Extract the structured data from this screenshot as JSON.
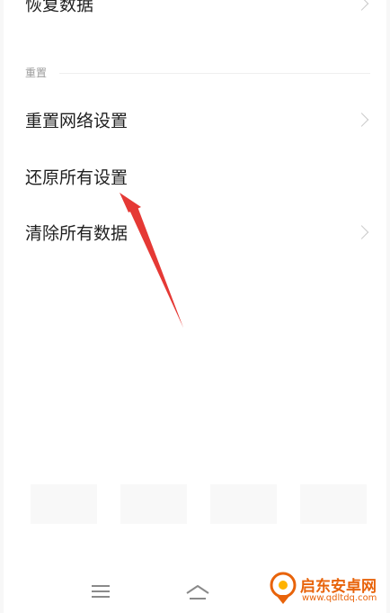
{
  "rows": {
    "restore_data": "恢复数据",
    "reset_network": "重置网络设置",
    "restore_all": "还原所有设置",
    "clear_all": "清除所有数据"
  },
  "section": {
    "reset_title": "重置"
  },
  "watermark": {
    "brand": "启东安卓网",
    "url": "www.qdltdq.com"
  },
  "colors": {
    "arrow": "#e53935",
    "watermark": "#e8630a"
  },
  "icons": {
    "chevron": "chevron-right-icon",
    "menu": "menu-icon",
    "home": "home-icon"
  }
}
